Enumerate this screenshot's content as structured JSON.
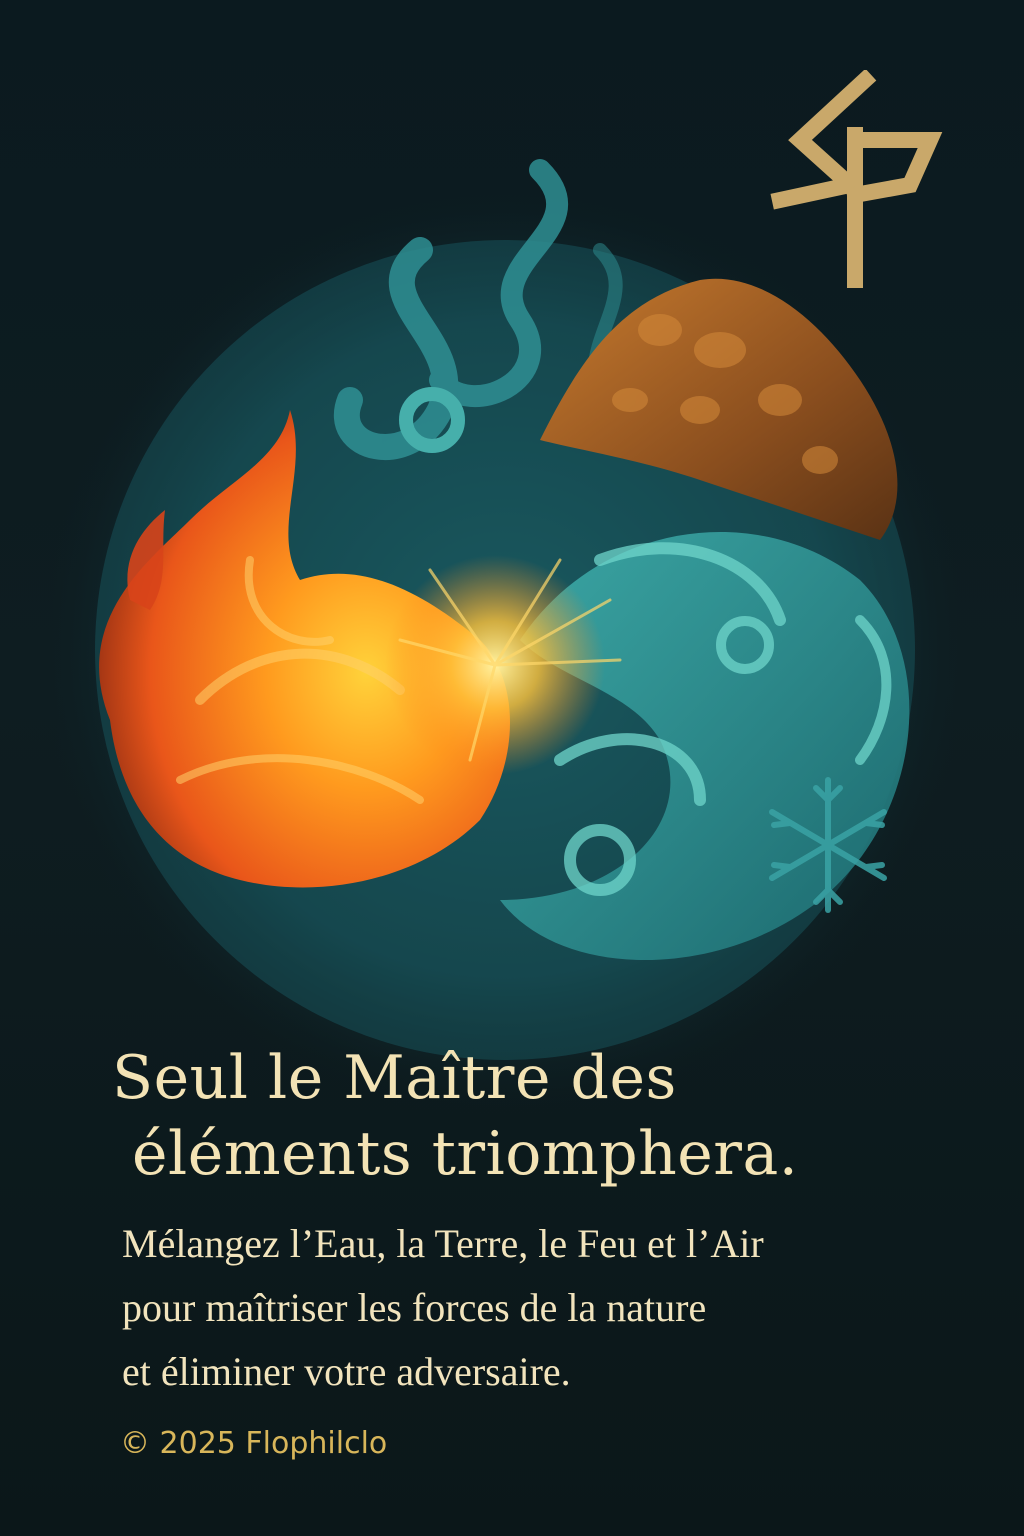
{
  "title": {
    "line1": "Seul le Maître des",
    "line2": "éléments triomphera."
  },
  "subtitle": {
    "line1": "Mélangez l’Eau, la Terre, le Feu et l’Air",
    "line2": "pour maîtriser les forces de la nature",
    "line3": "et éliminer votre adversaire."
  },
  "copyright": "© 2025 Flophilclo",
  "icons": {
    "logo": "sp-monogram-logo",
    "fire": "fire-flame-icon",
    "water": "water-wave-icon",
    "earth": "earth-rock-icon",
    "air": "air-swirl-icon",
    "snowflake": "snowflake-icon"
  },
  "colors": {
    "background": "#0d1a1e",
    "title": "#f3e3b5",
    "subtitle": "#f2e4bd",
    "copyright": "#d8b65a",
    "logo": "#c9a86a",
    "fire": "#ff8a1c",
    "water": "#2a8a8c",
    "earth": "#a8682a"
  }
}
